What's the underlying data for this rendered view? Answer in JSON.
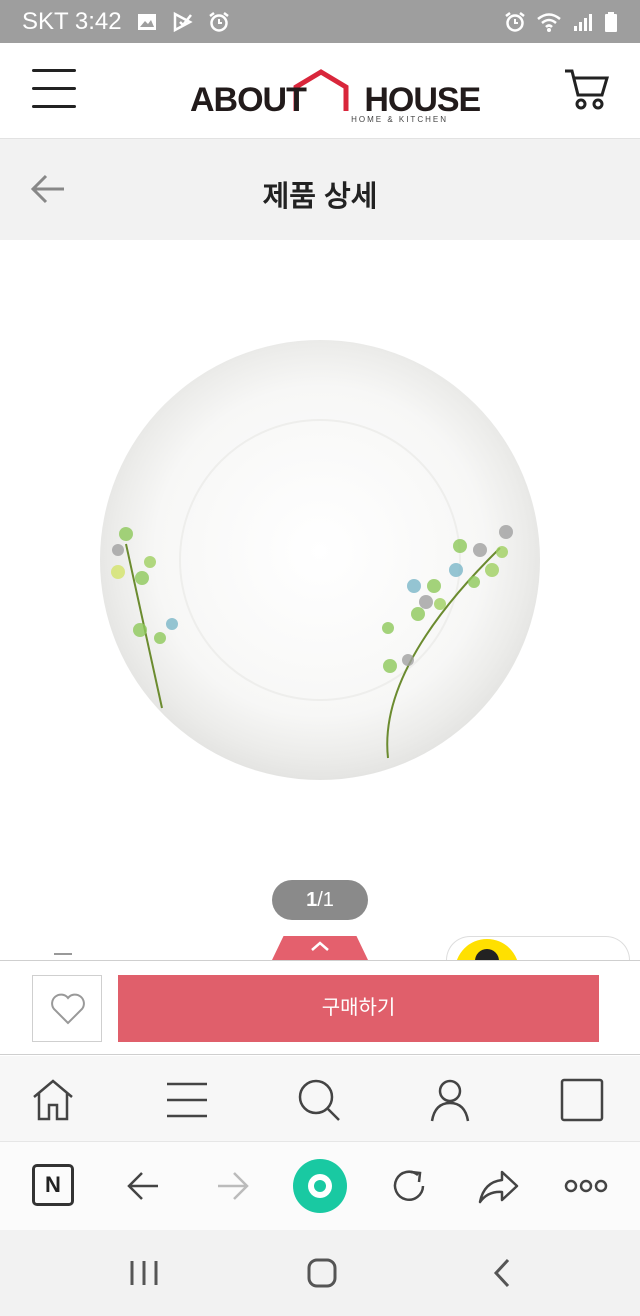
{
  "status_bar": {
    "carrier_time": "SKT 3:42",
    "icons_left": [
      "image-icon",
      "play-check-icon",
      "alarm-icon"
    ],
    "icons_right": [
      "alarm-icon",
      "wifi-icon",
      "signal-icon",
      "battery-icon"
    ]
  },
  "header": {
    "brand_name": "ABOUT HOUSE",
    "brand_sub": "HOME & KITCHEN",
    "brand_color": "#d9263b"
  },
  "title_bar": {
    "title": "제품 상세"
  },
  "gallery": {
    "pager_current": "1",
    "pager_separator": "/",
    "pager_total": "1"
  },
  "buy_bar": {
    "buy_label": "구매하기",
    "accent_color": "#e05f6b"
  },
  "bottom_nav": {
    "items": [
      "home-icon",
      "menu-icon",
      "search-icon",
      "user-icon",
      "tabs-icon"
    ]
  },
  "browser_toolbar": {
    "naver_label": "N",
    "items": [
      "back-icon",
      "forward-icon",
      "green-dot-icon",
      "refresh-icon",
      "share-icon",
      "more-icon"
    ]
  }
}
